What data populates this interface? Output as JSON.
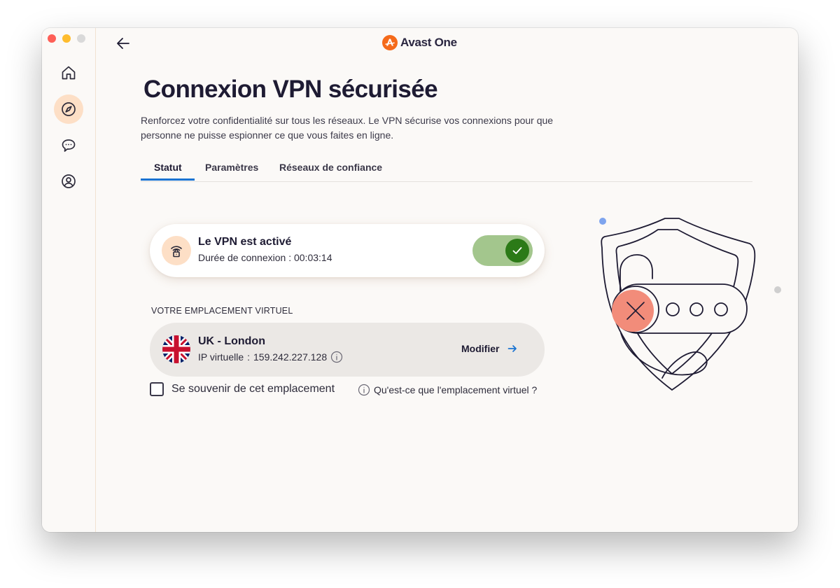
{
  "app": {
    "name": "Avast One",
    "brand_color": "#f56a1a"
  },
  "sidebar": {
    "items": [
      {
        "id": "home",
        "icon": "home-icon",
        "active": false
      },
      {
        "id": "explore",
        "icon": "compass-icon",
        "active": true
      },
      {
        "id": "messages",
        "icon": "chat-icon",
        "active": false
      },
      {
        "id": "account",
        "icon": "user-icon",
        "active": false
      }
    ]
  },
  "header": {
    "back_icon": "arrow-left-icon"
  },
  "page": {
    "title": "Connexion VPN sécurisée",
    "description": "Renforcez votre confidentialité sur tous les réseaux. Le VPN sécurise vos connexions pour que personne ne puisse espionner ce que vous faites en ligne."
  },
  "tabs": [
    {
      "label": "Statut",
      "active": true
    },
    {
      "label": "Paramètres",
      "active": false
    },
    {
      "label": "Réseaux de confiance",
      "active": false
    }
  ],
  "vpn": {
    "status": "Le VPN est activé",
    "duration_label": "Durée de connexion",
    "duration": "00:03:14",
    "enabled": true,
    "toggle_color": "#2b7a17"
  },
  "location": {
    "section_label": "VOTRE EMPLACEMENT VIRTUEL",
    "name": "UK - London",
    "ip_label": "IP virtuelle",
    "ip": "159.242.227.128",
    "modify_label": "Modifier",
    "flag": "uk-flag-icon"
  },
  "remember": {
    "label": "Se souvenir de cet emplacement",
    "checked": false
  },
  "help": {
    "label": "Qu'est-ce que l'emplacement virtuel ?"
  },
  "colors": {
    "accent": "#1a73d2",
    "active_nav_bg": "#fddfc6",
    "x_circle": "#f28c7a"
  }
}
